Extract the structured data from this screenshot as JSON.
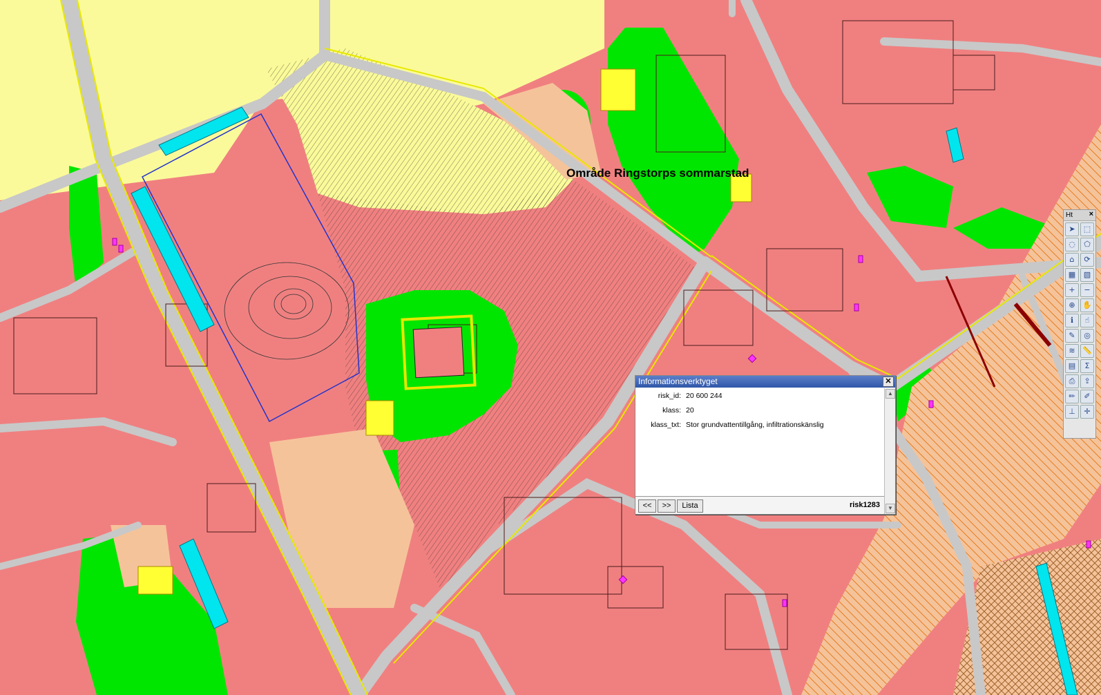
{
  "map": {
    "area_label": "Område Ringstorps sommarstad"
  },
  "info_window": {
    "title": "Informationsverktyget",
    "close_label": "✕",
    "fields": [
      {
        "key": "risk_id:",
        "value": "20 600 244"
      },
      {
        "key": "klass:",
        "value": "20"
      },
      {
        "key": "klass_txt:",
        "value": "Stor grundvattentillgång, infiltrationskänslig"
      }
    ],
    "prev_label": "<<",
    "next_label": ">>",
    "list_label": "Lista",
    "layer_name": "risk1283"
  },
  "toolbar": {
    "title": "Ht",
    "close_label": "×",
    "tools": [
      {
        "name": "select-arrow-icon"
      },
      {
        "name": "select-box-icon"
      },
      {
        "name": "select-circle-icon"
      },
      {
        "name": "select-polygon-icon"
      },
      {
        "name": "home-icon"
      },
      {
        "name": "refresh-icon"
      },
      {
        "name": "grid-icon"
      },
      {
        "name": "layers-off-icon"
      },
      {
        "name": "zoom-in-icon"
      },
      {
        "name": "zoom-out-icon"
      },
      {
        "name": "zoom-extent-icon"
      },
      {
        "name": "pan-hand-icon"
      },
      {
        "name": "info-icon"
      },
      {
        "name": "pointer-icon"
      },
      {
        "name": "measure-icon"
      },
      {
        "name": "locate-icon"
      },
      {
        "name": "layers-icon"
      },
      {
        "name": "ruler-icon"
      },
      {
        "name": "table-icon"
      },
      {
        "name": "sum-icon"
      },
      {
        "name": "print-icon"
      },
      {
        "name": "export-icon"
      },
      {
        "name": "draw-icon"
      },
      {
        "name": "edit-icon"
      },
      {
        "name": "scale-icon"
      },
      {
        "name": "north-arrow-icon"
      }
    ]
  },
  "colors": {
    "red_zone": "#f08080",
    "yellow_zone": "#fafa9a",
    "green_zone": "#00e600",
    "road": "#c8c8c8",
    "cyan": "#00e5ee",
    "tan": "#f5c39a"
  }
}
